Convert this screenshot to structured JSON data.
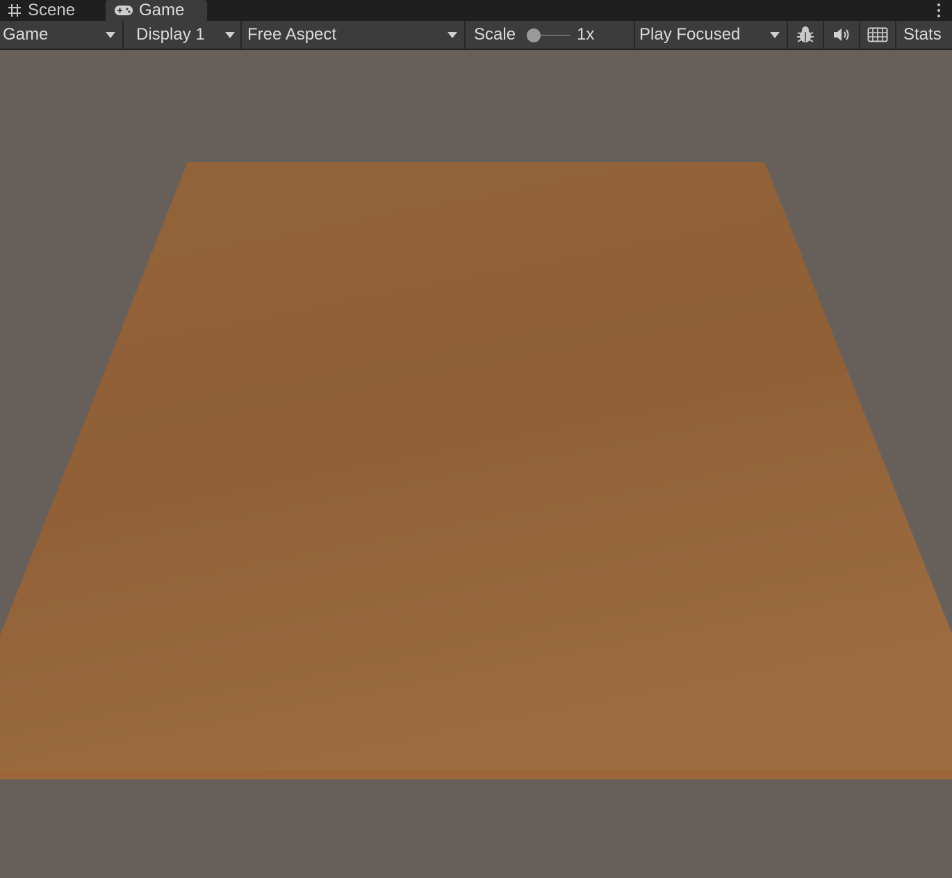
{
  "tabs": {
    "scene_label": "Scene",
    "game_label": "Game",
    "active": "Game"
  },
  "toolbar": {
    "view_mode": "Game",
    "display": "Display 1",
    "aspect": "Free Aspect",
    "scale_label": "Scale",
    "scale_value": "1x",
    "scale_level": 0,
    "play_mode": "Play Focused",
    "stats_label": "Stats"
  },
  "icons": {
    "scene_tab": "grid-hash-icon",
    "game_tab": "gamepad-icon",
    "bug": "bug-icon",
    "audio": "speaker-icon",
    "keyboard": "keyboard-icon",
    "more": "kebab-menu-icon"
  },
  "colors": {
    "editor_chrome": "#3c3c3c",
    "tab_strip": "#1f1f1f",
    "sky": "#67605a",
    "ground_plane": "#93633a"
  }
}
